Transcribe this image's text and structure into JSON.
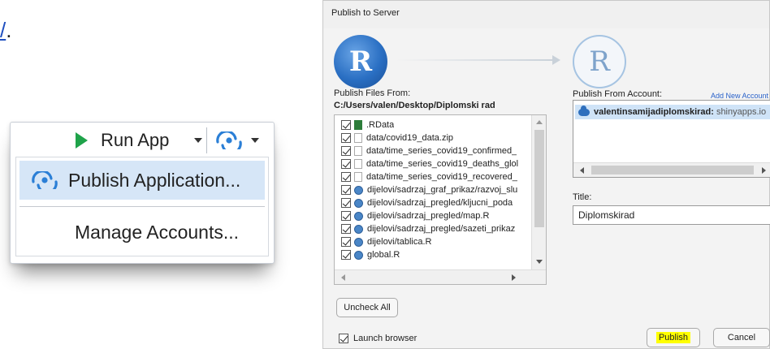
{
  "link_fragment": {
    "underlined": "/",
    "punct": "."
  },
  "menu": {
    "run_label": "Run App",
    "items": [
      {
        "label": "Publish Application..."
      },
      {
        "label": "Manage Accounts..."
      }
    ],
    "colors": {
      "run_icon": "#1fa34a",
      "publish_icon": "#2b7fd6",
      "highlight": "#d6e6f7"
    }
  },
  "dialog": {
    "title": "Publish to Server",
    "files_label": "Publish Files From:",
    "files_path": "C:/Users/valen/Desktop/Diplomski rad",
    "files": [
      {
        "name": ".RData",
        "icon": "rdata-icon",
        "checked": true
      },
      {
        "name": "data/covid19_data.zip",
        "icon": "file-icon",
        "checked": true
      },
      {
        "name": "data/time_series_covid19_confirmed_",
        "icon": "file-icon",
        "checked": true
      },
      {
        "name": "data/time_series_covid19_deaths_glol",
        "icon": "file-icon",
        "checked": true
      },
      {
        "name": "data/time_series_covid19_recovered_",
        "icon": "file-icon",
        "checked": true
      },
      {
        "name": "dijelovi/sadrzaj_graf_prikaz/razvoj_slu",
        "icon": "r-file-icon",
        "checked": true
      },
      {
        "name": "dijelovi/sadrzaj_pregled/kljucni_poda",
        "icon": "r-file-icon",
        "checked": true
      },
      {
        "name": "dijelovi/sadrzaj_pregled/map.R",
        "icon": "r-file-icon",
        "checked": true
      },
      {
        "name": "dijelovi/sadrzaj_pregled/sazeti_prikaz",
        "icon": "r-file-icon",
        "checked": true
      },
      {
        "name": "dijelovi/tablica.R",
        "icon": "r-file-icon",
        "checked": true
      },
      {
        "name": "global.R",
        "icon": "r-file-icon",
        "checked": true
      }
    ],
    "account_label": "Publish From Account:",
    "add_account": "Add New Account",
    "account_name": "valentinsamijadiplomskirad:",
    "account_server": "shinyapps.io",
    "title_label": "Title:",
    "title_value": "Diplomskirad",
    "uncheck_all": "Uncheck All",
    "launch_browser": "Launch browser",
    "publish": "Publish",
    "cancel": "Cancel",
    "logo_letter": "R",
    "colors": {
      "publish_highlight": "#ffff00",
      "selection": "#cfe3f7",
      "link": "#2a62c9"
    }
  }
}
